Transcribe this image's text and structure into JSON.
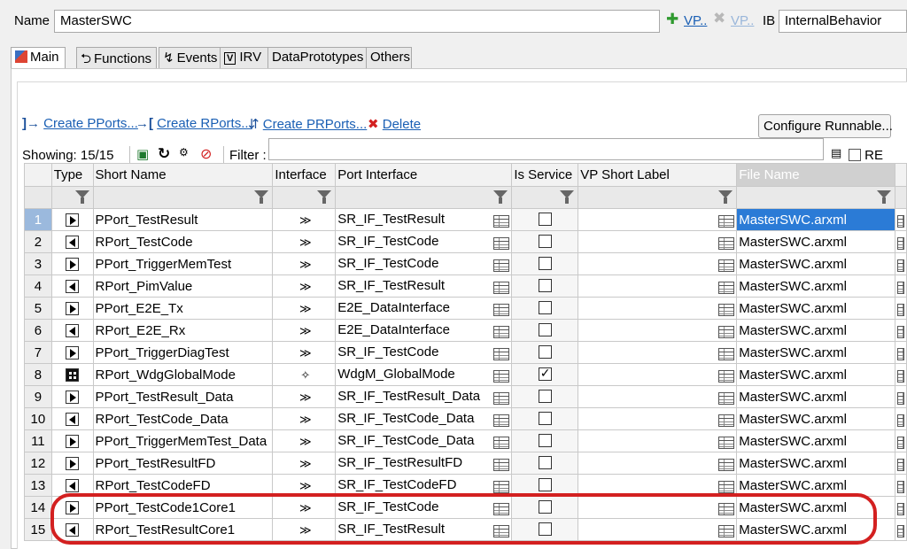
{
  "header": {
    "name_label": "Name",
    "name_value": "MasterSWC",
    "vp_add_label": "VP..",
    "vp_remove_label": "VP..",
    "ib_label": "IB",
    "ib_value": "InternalBehavior"
  },
  "tabs": [
    {
      "label": "Main",
      "icon": "main-tab-icon",
      "active": true
    },
    {
      "label": "Functions",
      "icon": "functions-icon"
    },
    {
      "label": "Events",
      "icon": "events-icon"
    },
    {
      "label": "IRV",
      "icon": "irv-icon"
    },
    {
      "label": "DataPrototypes"
    },
    {
      "label": "Others"
    }
  ],
  "actions": {
    "create_pports": "Create PPorts...",
    "create_rports": "Create RPorts...",
    "create_prports": "Create PRPorts...",
    "delete": "Delete",
    "configure_runnable": "Configure Runnable..."
  },
  "toolbar": {
    "showing": "Showing: 15/15",
    "filter_label": "Filter :",
    "filter_value": "",
    "re_label": "RE"
  },
  "table": {
    "columns": [
      "Type",
      "Short Name",
      "Interface",
      "Port Interface",
      "Is Service",
      "VP Short Label",
      "File Name"
    ],
    "rows": [
      {
        "n": "1",
        "type": "pport",
        "short_name": "PPort_TestResult",
        "port_interface": "SR_IF_TestResult",
        "is_service": false,
        "file": "MasterSWC.arxml"
      },
      {
        "n": "2",
        "type": "rport",
        "short_name": "RPort_TestCode",
        "port_interface": "SR_IF_TestCode",
        "is_service": false,
        "file": "MasterSWC.arxml"
      },
      {
        "n": "3",
        "type": "pport",
        "short_name": "PPort_TriggerMemTest",
        "port_interface": "SR_IF_TestCode",
        "is_service": false,
        "file": "MasterSWC.arxml"
      },
      {
        "n": "4",
        "type": "rport",
        "short_name": "RPort_PimValue",
        "port_interface": "SR_IF_TestResult",
        "is_service": false,
        "file": "MasterSWC.arxml"
      },
      {
        "n": "5",
        "type": "pport",
        "short_name": "PPort_E2E_Tx",
        "port_interface": "E2E_DataInterface",
        "is_service": false,
        "file": "MasterSWC.arxml"
      },
      {
        "n": "6",
        "type": "rport",
        "short_name": "RPort_E2E_Rx",
        "port_interface": "E2E_DataInterface",
        "is_service": false,
        "file": "MasterSWC.arxml"
      },
      {
        "n": "7",
        "type": "pport",
        "short_name": "PPort_TriggerDiagTest",
        "port_interface": "SR_IF_TestCode",
        "is_service": false,
        "file": "MasterSWC.arxml"
      },
      {
        "n": "8",
        "type": "service",
        "short_name": "RPort_WdgGlobalMode",
        "port_interface": "WdgM_GlobalMode",
        "is_service": true,
        "file": "MasterSWC.arxml"
      },
      {
        "n": "9",
        "type": "pport",
        "short_name": "PPort_TestResult_Data",
        "port_interface": "SR_IF_TestResult_Data",
        "is_service": false,
        "file": "MasterSWC.arxml"
      },
      {
        "n": "10",
        "type": "rport",
        "short_name": "RPort_TestCode_Data",
        "port_interface": "SR_IF_TestCode_Data",
        "is_service": false,
        "file": "MasterSWC.arxml"
      },
      {
        "n": "11",
        "type": "pport",
        "short_name": "PPort_TriggerMemTest_Data",
        "port_interface": "SR_IF_TestCode_Data",
        "is_service": false,
        "file": "MasterSWC.arxml"
      },
      {
        "n": "12",
        "type": "pport",
        "short_name": "PPort_TestResultFD",
        "port_interface": "SR_IF_TestResultFD",
        "is_service": false,
        "file": "MasterSWC.arxml"
      },
      {
        "n": "13",
        "type": "rport",
        "short_name": "RPort_TestCodeFD",
        "port_interface": "SR_IF_TestCodeFD",
        "is_service": false,
        "file": "MasterSWC.arxml"
      },
      {
        "n": "14",
        "type": "pport",
        "short_name": "PPort_TestCode1Core1",
        "port_interface": "SR_IF_TestCode",
        "is_service": false,
        "file": "MasterSWC.arxml"
      },
      {
        "n": "15",
        "type": "rport",
        "short_name": "RPort_TestResultCore1",
        "port_interface": "SR_IF_TestResult",
        "is_service": false,
        "file": "MasterSWC.arxml"
      }
    ]
  },
  "colors": {
    "highlight": "#d32020",
    "link": "#1a5fb4",
    "selection": "#2b7bd6"
  }
}
